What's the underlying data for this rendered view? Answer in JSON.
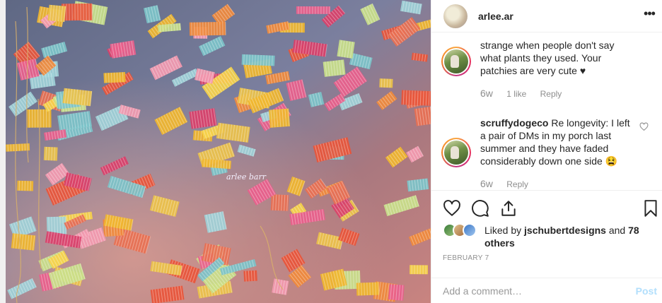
{
  "post": {
    "username": "arlee.ar",
    "more_icon": "more-horizontal-icon",
    "image_watermark": "arlee barr"
  },
  "comments": [
    {
      "text": "strange when people don't say what plants they used. Your patchies are very cute ♥",
      "age": "6w",
      "likes": "1 like",
      "reply": "Reply"
    },
    {
      "user": "scruffydogeco",
      "text": " Re longevity: I left a pair of DMs in my porch last summer and they have faded considerably down one side 😫",
      "age": "6w",
      "reply": "Reply"
    }
  ],
  "actions": {
    "like_icon": "heart-icon",
    "comment_icon": "comment-bubble-icon",
    "share_icon": "share-icon",
    "save_icon": "bookmark-icon"
  },
  "likes": {
    "prefix": "Liked by ",
    "user": "jschubertdesigns",
    "middle": " and ",
    "others": "78 others"
  },
  "date": "FEBRUARY 7",
  "add_comment": {
    "placeholder": "Add a comment…",
    "post_label": "Post"
  },
  "colors": {
    "link_disabled": "#b2dffc",
    "muted": "#8e8e8e",
    "text": "#262626"
  }
}
